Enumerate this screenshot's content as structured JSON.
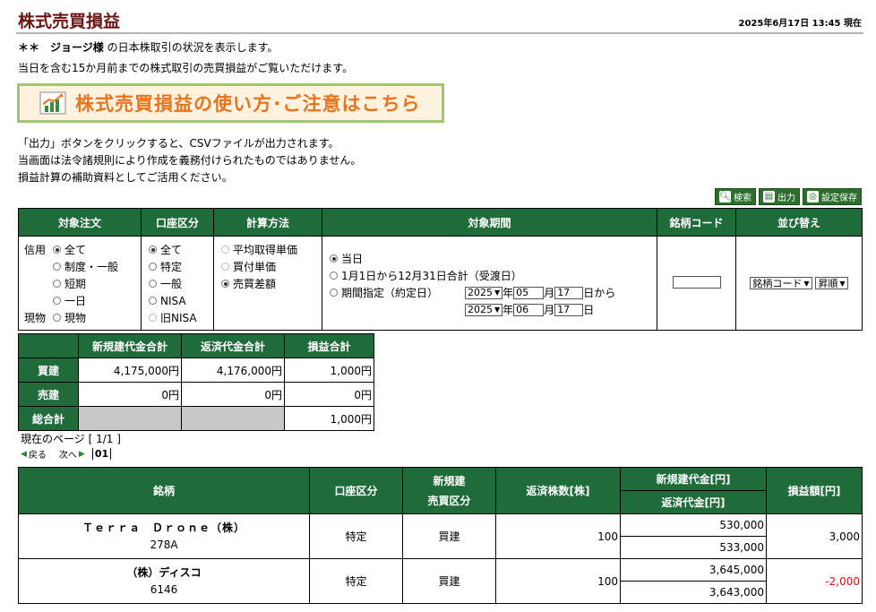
{
  "page": {
    "title": "株式売買損益",
    "timestamp": "2025年6月17日 13:45 現在"
  },
  "intro": {
    "prefix": "＊＊　ジョージ様",
    "suffix": " の日本株取引の状況を表示します。",
    "line2": "当日を含む15か月前までの株式取引の売買損益がご覧いただけます。"
  },
  "banner": {
    "label": "株式売買損益の使い方･ご注意はこちら",
    "icon": "chart-up-icon"
  },
  "notes": [
    "「出力」ボタンをクリックすると、CSVファイルが出力されます。",
    "当画面は法令諸規則により作成を義務付けられたものではありません。",
    "損益計算の補助資料としてご活用ください。"
  ],
  "toolbar": {
    "search": "検索",
    "output": "出力",
    "save": "設定保存"
  },
  "search": {
    "headers": [
      "対象注文",
      "口座区分",
      "計算方法",
      "対象期間",
      "銘柄コード",
      "並び替え"
    ],
    "order": {
      "credit_label": "信用",
      "genbutsu_label": "現物",
      "options": [
        "全て",
        "制度・一般",
        "短期",
        "一日",
        "現物"
      ]
    },
    "account": {
      "options": [
        "全て",
        "特定",
        "一般",
        "NISA",
        "旧NISA"
      ]
    },
    "calc": {
      "options": [
        "平均取得単価",
        "買付単価",
        "売買差額"
      ]
    },
    "period": {
      "options": [
        "当日",
        "1月1日から12月31日合計（受渡日）",
        "期間指定（約定日）"
      ],
      "from": {
        "year": "2025",
        "month": "05",
        "day": "17",
        "year_unit": "年",
        "month_unit": "月",
        "day_unit": "日から"
      },
      "to": {
        "year": "2025",
        "month": "06",
        "day": "17",
        "year_unit": "年",
        "month_unit": "月",
        "day_unit": "日"
      }
    },
    "code": {
      "value": ""
    },
    "sort": {
      "field": "銘柄コード",
      "order": "昇順"
    }
  },
  "summary": {
    "headers": [
      "",
      "新規建代金合計",
      "返済代金合計",
      "損益合計"
    ],
    "rows": [
      {
        "label": "買建",
        "open": "4,175,000円",
        "close": "4,176,000円",
        "pl": "1,000円"
      },
      {
        "label": "売建",
        "open": "0円",
        "close": "0円",
        "pl": "0円"
      },
      {
        "label": "総合計",
        "pl": "1,000円"
      }
    ]
  },
  "pager": {
    "info": "現在のページ [ 1/1 ]",
    "prev": "戻る",
    "next": "次へ",
    "current": "01"
  },
  "results": {
    "headers": {
      "name": "銘柄",
      "account": "口座区分",
      "type": "新規建\n売買区分",
      "qty": "返済株数[株]",
      "open": "新規建代金[円]",
      "close": "返済代金[円]",
      "pl": "損益額[円]"
    },
    "rows": [
      {
        "name": "Ｔｅｒｒａ　Ｄｒｏｎｅ（株）",
        "code": "278A",
        "account": "特定",
        "type": "買建",
        "qty": "100",
        "open": "530,000",
        "close": "533,000",
        "pl": "3,000"
      },
      {
        "name": "（株）ディスコ",
        "code": "6146",
        "account": "特定",
        "type": "買建",
        "qty": "100",
        "open": "3,645,000",
        "close": "3,643,000",
        "pl": "-2,000"
      }
    ]
  },
  "colors": {
    "header_green": "#1f6b3a",
    "title": "#6b1414",
    "banner_text": "#e8741d",
    "negative": "#dd1111"
  }
}
